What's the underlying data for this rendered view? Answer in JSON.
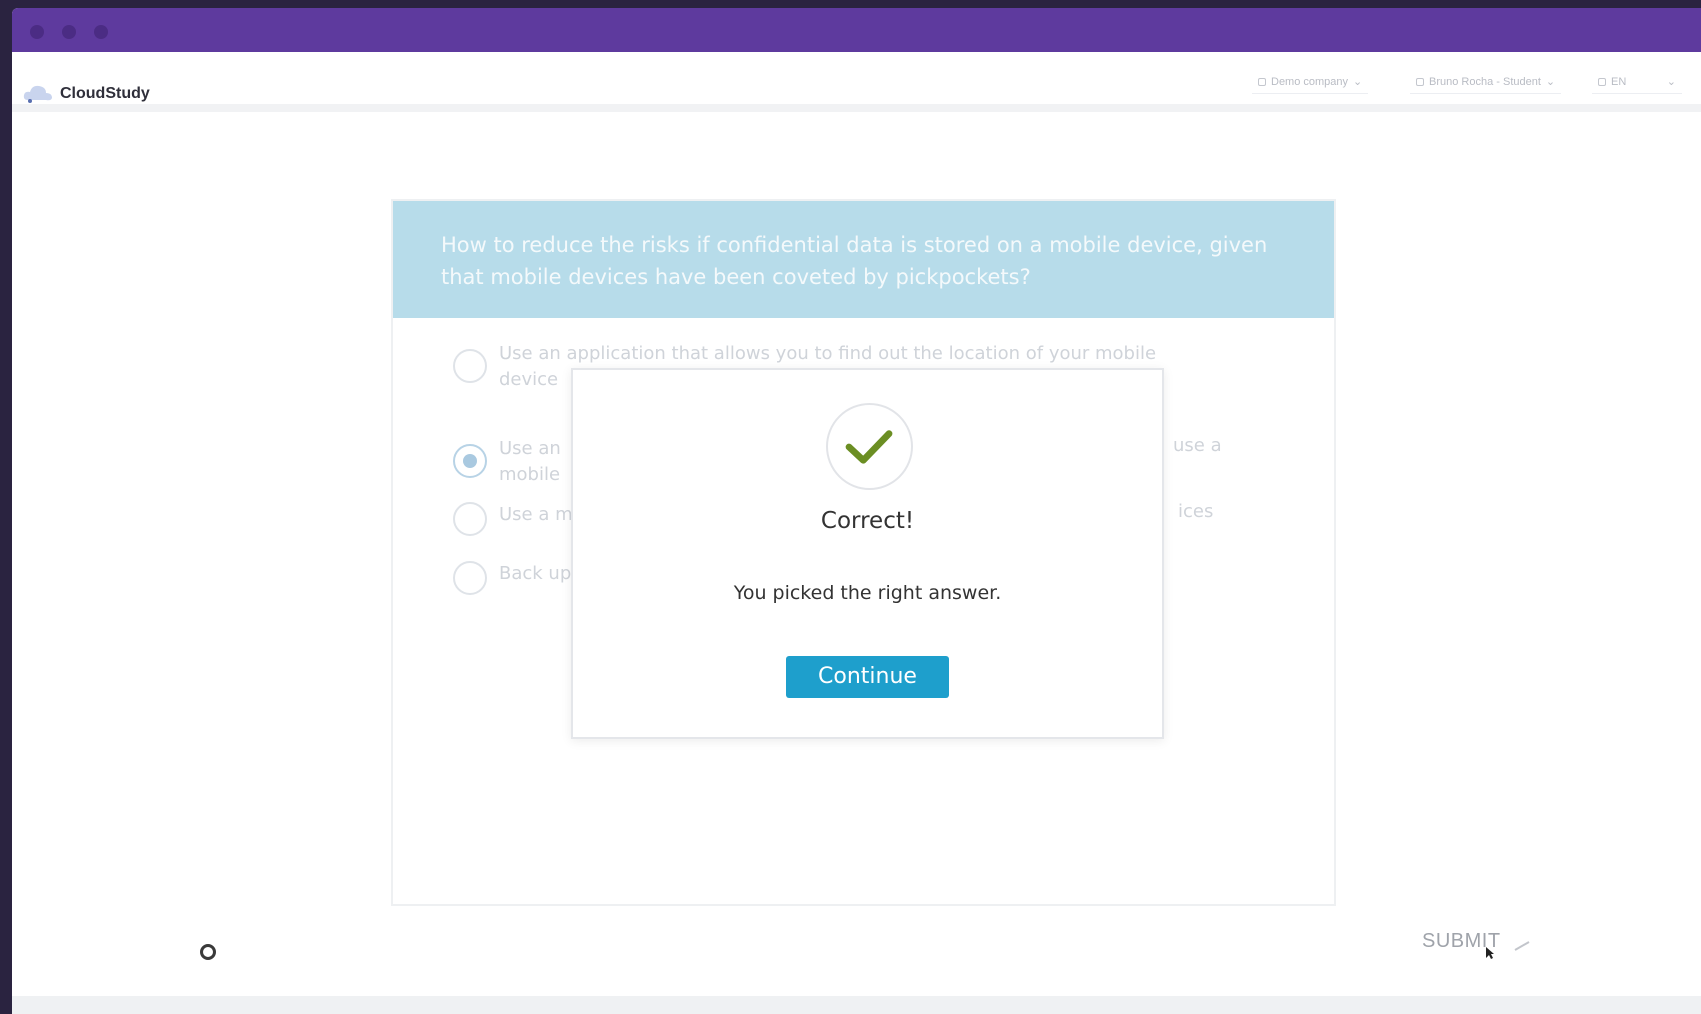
{
  "app": {
    "brand": "CloudStudy",
    "header": {
      "company_label": "Demo company",
      "user_label": "Bruno Rocha - Student",
      "language_label": "EN"
    }
  },
  "quiz": {
    "question": "How to reduce the risks if confidential data is stored on a mobile device, given that mobile devices have been coveted by pickpockets?",
    "options": [
      {
        "label": "Use an application that allows you to find out the location of your mobile device",
        "selected": false
      },
      {
        "label": "Use an",
        "tail": "use a",
        "line2": "mobile",
        "selected": true
      },
      {
        "label": "Use a m",
        "tail": "ices",
        "selected": false
      },
      {
        "label": "Back up",
        "selected": false
      }
    ],
    "submit_label": "SUBMIT"
  },
  "dialog": {
    "title": "Correct!",
    "message": "You picked the right answer.",
    "button_label": "Continue",
    "icon": "check-icon"
  },
  "colors": {
    "titlebar": "#5e3a9e",
    "question_header": "#b7dcea",
    "button": "#1e9fcc",
    "check": "#6b8e23"
  }
}
